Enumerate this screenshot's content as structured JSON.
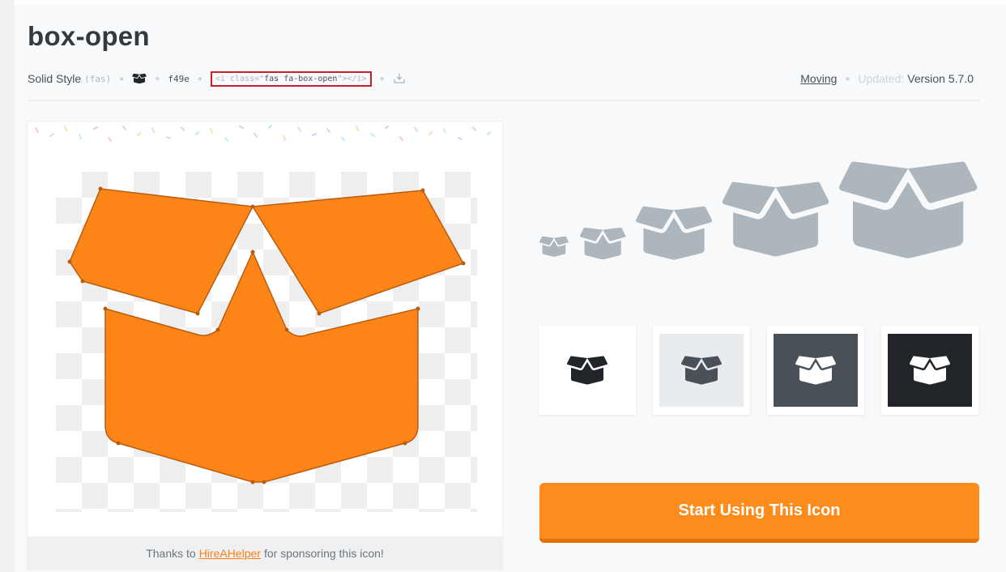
{
  "icon": {
    "name": "box-open",
    "style_label": "Solid Style",
    "style_prefix": "(fas)",
    "unicode": "f49e",
    "html_pre": "<i class=\"",
    "html_class": "fas fa-box-open",
    "html_post": "\"></i>",
    "category": "Moving",
    "updated_label": "Updated:",
    "version": "Version 5.7.0"
  },
  "sponsor": {
    "pre": "Thanks to",
    "link": "HireAHelper",
    "post": "for sponsoring this icon!"
  },
  "cta": {
    "label": "Start Using This Icon"
  },
  "colors": {
    "accent": "#fd8c1c",
    "preview_icon": "#fd8517",
    "size_icon": "#adb5bd",
    "swatch_bgs": [
      "#ffffff",
      "#e9ecef",
      "#495057",
      "#212529"
    ],
    "swatch_fgs": [
      "#212529",
      "#495057",
      "#ffffff",
      "#ffffff"
    ]
  }
}
